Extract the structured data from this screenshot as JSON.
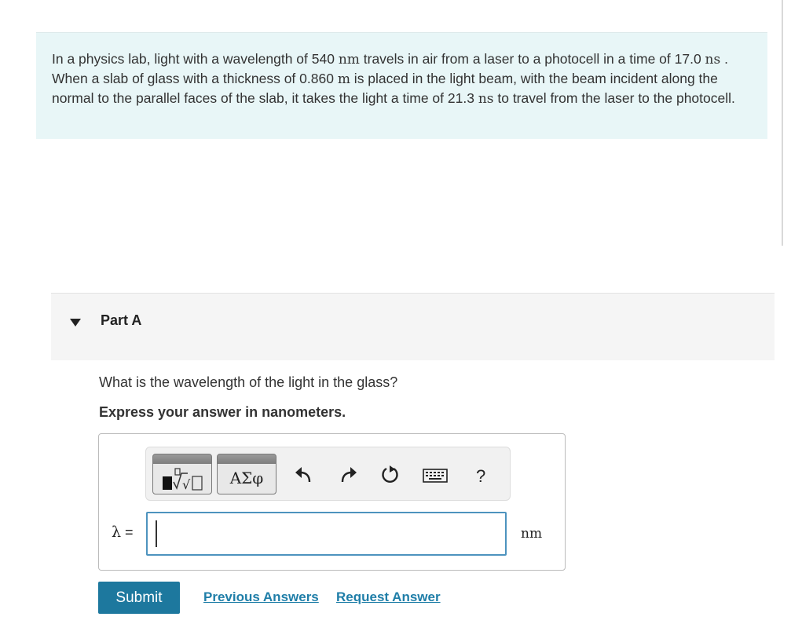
{
  "problem": {
    "t1": "In a physics lab, light with a wavelength of 540 ",
    "u1": "nm",
    "t2": " travels in air from a laser to a photocell in a time of 17.0 ",
    "u2": "ns",
    "t3": " . When a slab of glass with a thickness of 0.860 ",
    "u3": "m",
    "t4": " is placed in the light beam, with the beam incident along the normal to the parallel faces of the slab, it takes the light a time of 21.3 ",
    "u4": "ns",
    "t5": " to travel from the laser to the photocell."
  },
  "part": {
    "title": "Part A"
  },
  "question": "What is the wavelength of the light in the glass?",
  "instruction": "Express your answer in nanometers.",
  "toolbar": {
    "symbols_label": "ΑΣφ",
    "help_label": "?",
    "icons": [
      "templates-icon",
      "undo-icon",
      "redo-icon",
      "reset-icon",
      "keyboard-icon",
      "help-icon"
    ]
  },
  "answer": {
    "variable": "λ",
    "equals": " =",
    "value": "",
    "unit": "nm"
  },
  "actions": {
    "submit": "Submit",
    "previous_answers": "Previous Answers",
    "request_answer": "Request Answer"
  },
  "colors": {
    "problem_bg": "#e8f6f7",
    "part_bg": "#f5f5f5",
    "submit_bg": "#1d789e",
    "link": "#1f7ea8",
    "input_border": "#4d93be"
  }
}
